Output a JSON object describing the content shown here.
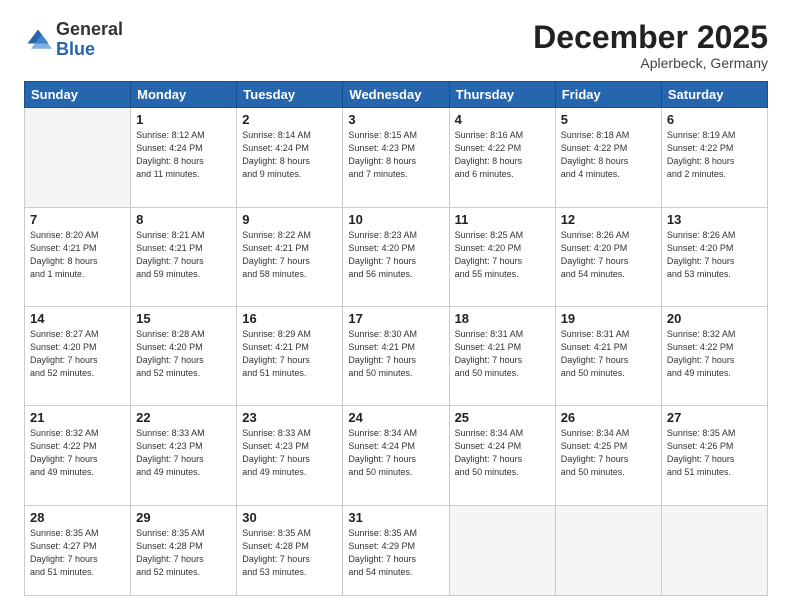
{
  "header": {
    "logo_general": "General",
    "logo_blue": "Blue",
    "month_title": "December 2025",
    "location": "Aplerbeck, Germany"
  },
  "days_of_week": [
    "Sunday",
    "Monday",
    "Tuesday",
    "Wednesday",
    "Thursday",
    "Friday",
    "Saturday"
  ],
  "weeks": [
    [
      {
        "day": "",
        "info": ""
      },
      {
        "day": "1",
        "info": "Sunrise: 8:12 AM\nSunset: 4:24 PM\nDaylight: 8 hours\nand 11 minutes."
      },
      {
        "day": "2",
        "info": "Sunrise: 8:14 AM\nSunset: 4:24 PM\nDaylight: 8 hours\nand 9 minutes."
      },
      {
        "day": "3",
        "info": "Sunrise: 8:15 AM\nSunset: 4:23 PM\nDaylight: 8 hours\nand 7 minutes."
      },
      {
        "day": "4",
        "info": "Sunrise: 8:16 AM\nSunset: 4:22 PM\nDaylight: 8 hours\nand 6 minutes."
      },
      {
        "day": "5",
        "info": "Sunrise: 8:18 AM\nSunset: 4:22 PM\nDaylight: 8 hours\nand 4 minutes."
      },
      {
        "day": "6",
        "info": "Sunrise: 8:19 AM\nSunset: 4:22 PM\nDaylight: 8 hours\nand 2 minutes."
      }
    ],
    [
      {
        "day": "7",
        "info": "Sunrise: 8:20 AM\nSunset: 4:21 PM\nDaylight: 8 hours\nand 1 minute."
      },
      {
        "day": "8",
        "info": "Sunrise: 8:21 AM\nSunset: 4:21 PM\nDaylight: 7 hours\nand 59 minutes."
      },
      {
        "day": "9",
        "info": "Sunrise: 8:22 AM\nSunset: 4:21 PM\nDaylight: 7 hours\nand 58 minutes."
      },
      {
        "day": "10",
        "info": "Sunrise: 8:23 AM\nSunset: 4:20 PM\nDaylight: 7 hours\nand 56 minutes."
      },
      {
        "day": "11",
        "info": "Sunrise: 8:25 AM\nSunset: 4:20 PM\nDaylight: 7 hours\nand 55 minutes."
      },
      {
        "day": "12",
        "info": "Sunrise: 8:26 AM\nSunset: 4:20 PM\nDaylight: 7 hours\nand 54 minutes."
      },
      {
        "day": "13",
        "info": "Sunrise: 8:26 AM\nSunset: 4:20 PM\nDaylight: 7 hours\nand 53 minutes."
      }
    ],
    [
      {
        "day": "14",
        "info": "Sunrise: 8:27 AM\nSunset: 4:20 PM\nDaylight: 7 hours\nand 52 minutes."
      },
      {
        "day": "15",
        "info": "Sunrise: 8:28 AM\nSunset: 4:20 PM\nDaylight: 7 hours\nand 52 minutes."
      },
      {
        "day": "16",
        "info": "Sunrise: 8:29 AM\nSunset: 4:21 PM\nDaylight: 7 hours\nand 51 minutes."
      },
      {
        "day": "17",
        "info": "Sunrise: 8:30 AM\nSunset: 4:21 PM\nDaylight: 7 hours\nand 50 minutes."
      },
      {
        "day": "18",
        "info": "Sunrise: 8:31 AM\nSunset: 4:21 PM\nDaylight: 7 hours\nand 50 minutes."
      },
      {
        "day": "19",
        "info": "Sunrise: 8:31 AM\nSunset: 4:21 PM\nDaylight: 7 hours\nand 50 minutes."
      },
      {
        "day": "20",
        "info": "Sunrise: 8:32 AM\nSunset: 4:22 PM\nDaylight: 7 hours\nand 49 minutes."
      }
    ],
    [
      {
        "day": "21",
        "info": "Sunrise: 8:32 AM\nSunset: 4:22 PM\nDaylight: 7 hours\nand 49 minutes."
      },
      {
        "day": "22",
        "info": "Sunrise: 8:33 AM\nSunset: 4:23 PM\nDaylight: 7 hours\nand 49 minutes."
      },
      {
        "day": "23",
        "info": "Sunrise: 8:33 AM\nSunset: 4:23 PM\nDaylight: 7 hours\nand 49 minutes."
      },
      {
        "day": "24",
        "info": "Sunrise: 8:34 AM\nSunset: 4:24 PM\nDaylight: 7 hours\nand 50 minutes."
      },
      {
        "day": "25",
        "info": "Sunrise: 8:34 AM\nSunset: 4:24 PM\nDaylight: 7 hours\nand 50 minutes."
      },
      {
        "day": "26",
        "info": "Sunrise: 8:34 AM\nSunset: 4:25 PM\nDaylight: 7 hours\nand 50 minutes."
      },
      {
        "day": "27",
        "info": "Sunrise: 8:35 AM\nSunset: 4:26 PM\nDaylight: 7 hours\nand 51 minutes."
      }
    ],
    [
      {
        "day": "28",
        "info": "Sunrise: 8:35 AM\nSunset: 4:27 PM\nDaylight: 7 hours\nand 51 minutes."
      },
      {
        "day": "29",
        "info": "Sunrise: 8:35 AM\nSunset: 4:28 PM\nDaylight: 7 hours\nand 52 minutes."
      },
      {
        "day": "30",
        "info": "Sunrise: 8:35 AM\nSunset: 4:28 PM\nDaylight: 7 hours\nand 53 minutes."
      },
      {
        "day": "31",
        "info": "Sunrise: 8:35 AM\nSunset: 4:29 PM\nDaylight: 7 hours\nand 54 minutes."
      },
      {
        "day": "",
        "info": ""
      },
      {
        "day": "",
        "info": ""
      },
      {
        "day": "",
        "info": ""
      }
    ]
  ]
}
